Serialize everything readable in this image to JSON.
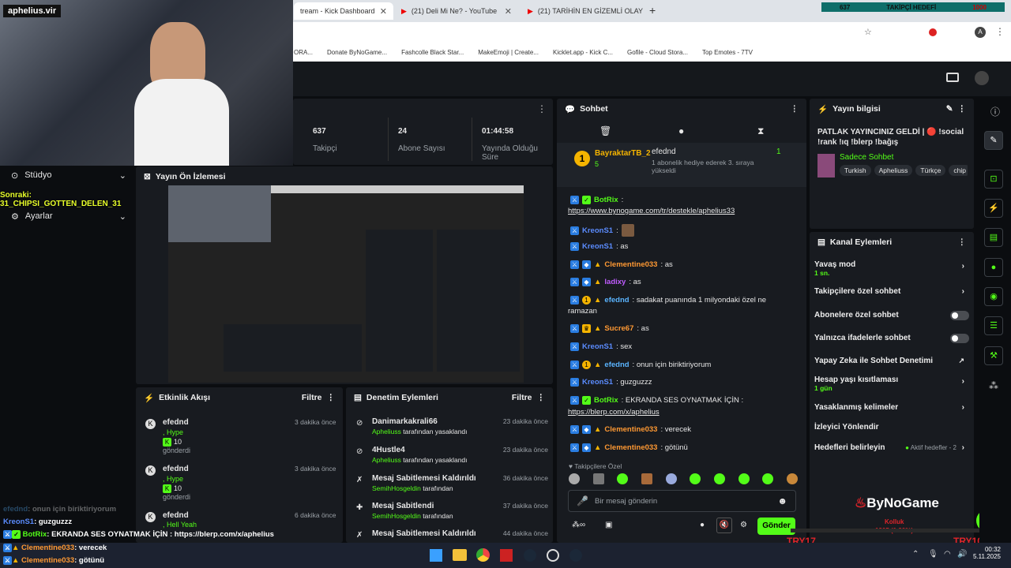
{
  "browser": {
    "tabs": [
      {
        "title": "tream - Kick Dashboard"
      },
      {
        "title": "(21) Deli Mi Ne? - YouTube"
      },
      {
        "title": "(21) TARİHİN EN GİZEMLİ OLAY"
      }
    ],
    "bookmarks": [
      "ORA...",
      "Donate ByNoGame...",
      "Fashcolle Black Star...",
      "MakeEmoji | Create...",
      "Kicklet.app - Kick C...",
      "Gofile - Cloud Stora...",
      "Top Emotes - 7TV"
    ]
  },
  "overlay": {
    "channel_tag": "aphelius.vir",
    "follower_goal_count": "637",
    "follower_goal_label": "TAKİPÇİ HEDEFİ",
    "follower_goal_target": "1000",
    "alert_text": "Sonraki: 31_CHIPSI_GOTTEN_DELEN_31",
    "brand": "ByNoGame",
    "try_left": "TRY17",
    "try_right": "TRY10000",
    "donation_label": "Kolluk",
    "donation_value": "1905 (1.90%)"
  },
  "stats": [
    {
      "value": "637",
      "label": "Takipçi"
    },
    {
      "value": "24",
      "label": "Abone Sayısı"
    },
    {
      "value": "01:44:58",
      "label": "Yayında Olduğu Süre"
    }
  ],
  "sidebar": {
    "studio": "Stüdyo",
    "settings": "Ayarlar",
    "preview_title": "Yayın Ön İzlemesi"
  },
  "activity": {
    "title": "Etkinlik Akışı",
    "filter": "Filtre",
    "items": [
      {
        "user": "efednd",
        "type": ", Hype",
        "amount": "10",
        "action": "gönderdi",
        "time": "3 dakika önce"
      },
      {
        "user": "efednd",
        "type": ", Hype",
        "amount": "10",
        "action": "gönderdi",
        "time": "3 dakika önce"
      },
      {
        "user": "efednd",
        "type": ", Hell Yeah",
        "amount": "",
        "action": "",
        "time": "6 dakika önce"
      }
    ]
  },
  "moderation": {
    "title": "Denetim Eylemleri",
    "filter": "Filtre",
    "items": [
      {
        "title": "Danimarkakrali66",
        "by": "Apheliuss",
        "suffix": "tarafından yasaklandı",
        "time": "23 dakika önce"
      },
      {
        "title": "4Hustle4",
        "by": "Apheliuss",
        "suffix": "tarafından yasaklandı",
        "time": "23 dakika önce"
      },
      {
        "title": "Mesaj Sabitlemesi Kaldırıldı",
        "by": "SemihHosgeldin",
        "suffix": "tarafından",
        "time": "36 dakika önce"
      },
      {
        "title": "Mesaj Sabitlendi",
        "by": "SemihHosgeldin",
        "suffix": "tarafından",
        "time": "37 dakika önce"
      },
      {
        "title": "Mesaj Sabitlemesi Kaldırıldı",
        "by": "",
        "suffix": "",
        "time": "44 dakika önce"
      }
    ]
  },
  "chat": {
    "title": "Sohbet",
    "pinned_user": "BayraktarTB_2",
    "pinned_count": "5",
    "gift_user": "efednd",
    "gift_text": "1 abonelik hediye ederek 3. sıraya yükseldi",
    "gift_count": "1",
    "messages": [
      {
        "user": "BotRix",
        "text": ":",
        "link": "https://www.bynogame.com/tr/destekle/aphelius33",
        "color": "#53fc18"
      },
      {
        "user": "KreonS1",
        "text": ":",
        "link": "",
        "color": "#5b8cff"
      },
      {
        "user": "KreonS1",
        "text": ": as",
        "link": "",
        "color": "#5b8cff"
      },
      {
        "user": "Clementine033",
        "text": ": as",
        "link": "",
        "color": "#ff9933"
      },
      {
        "user": "ladixy",
        "text": ": as",
        "link": "",
        "color": "#c05cff"
      },
      {
        "user": "efednd",
        "text": ": sadakat puanında 1 milyondaki özel ne",
        "link": "",
        "color": "#5ab4ff",
        "cont": "ramazan"
      },
      {
        "user": "Sucre67",
        "text": ": as",
        "link": "",
        "color": "#ff9933"
      },
      {
        "user": "KreonS1",
        "text": ": sex",
        "link": "",
        "color": "#5b8cff"
      },
      {
        "user": "efednd",
        "text": ": onun için biriktiriyorum",
        "link": "",
        "color": "#5ab4ff"
      },
      {
        "user": "KreonS1",
        "text": ": guzguzzz",
        "link": "",
        "color": "#5b8cff"
      },
      {
        "user": "BotRix",
        "text": ": EKRANDA SES OYNATMAK İÇİN :",
        "link": "https://blerp.com/x/aphelius",
        "color": "#53fc18"
      },
      {
        "user": "Clementine033",
        "text": ": verecek",
        "link": "",
        "color": "#ff9933"
      },
      {
        "user": "Clementine033",
        "text": ": götünü",
        "link": "",
        "color": "#ff9933"
      }
    ],
    "emote_label": "Takipçilere Özel",
    "input_placeholder": "Bir mesaj gönderin",
    "send": "Gönder"
  },
  "stream_info": {
    "title": "Yayın bilgisi",
    "stream_title": "PATLAK YAYINCINIZ GELDİ | 🔴 !social !rank !ıq !blerp !bağış",
    "category": "Sadece Sohbet",
    "tags": [
      "Turkish",
      "Apheliuss",
      "Türkçe",
      "chip"
    ]
  },
  "channel_actions": {
    "title": "Kanal Eylemleri",
    "items": [
      {
        "label": "Yavaş mod",
        "sub": "1 sn.",
        "ctrl": "chevron"
      },
      {
        "label": "Takipçilere özel sohbet",
        "sub": "",
        "ctrl": "chevron"
      },
      {
        "label": "Abonelere özel sohbet",
        "sub": "",
        "ctrl": "toggle"
      },
      {
        "label": "Yalnızca ifadelerle sohbet",
        "sub": "",
        "ctrl": "toggle"
      },
      {
        "label": "Yapay Zeka ile Sohbet Denetimi",
        "sub": "",
        "ctrl": "external"
      },
      {
        "label": "Hesap yaşı kısıtlaması",
        "sub": "1 gün",
        "ctrl": "chevron"
      },
      {
        "label": "Yasaklanmış kelimeler",
        "sub": "",
        "ctrl": "chevron"
      },
      {
        "label": "İzleyici Yönlendir",
        "sub": "",
        "ctrl": "none"
      },
      {
        "label": "Hedefleri belirleyin",
        "sub": "",
        "ctrl": "chevron",
        "extra": "Aktif hedefler - 2"
      }
    ]
  },
  "overlay_chat": [
    {
      "user": "efednd",
      "text": ": onun için biriktiriyorum",
      "color": "#5ab4ff"
    },
    {
      "user": "KreonS1",
      "text": ": guzguzzz",
      "color": "#5b8cff"
    },
    {
      "user": "BotRix",
      "text": ": EKRANDA SES OYNATMAK İÇİN : https://blerp.com/x/aphelius",
      "color": "#53fc18"
    },
    {
      "user": "Clementine033",
      "text": ": verecek",
      "color": "#ff9933"
    },
    {
      "user": "Clementine033",
      "text": ": götünü",
      "color": "#ff9933"
    }
  ],
  "taskbar": {
    "time": "00:32",
    "date": "5.11.2025"
  },
  "colors": {
    "accent": "#53fc18",
    "panel": "#181b20",
    "bg": "#0b0d10"
  }
}
